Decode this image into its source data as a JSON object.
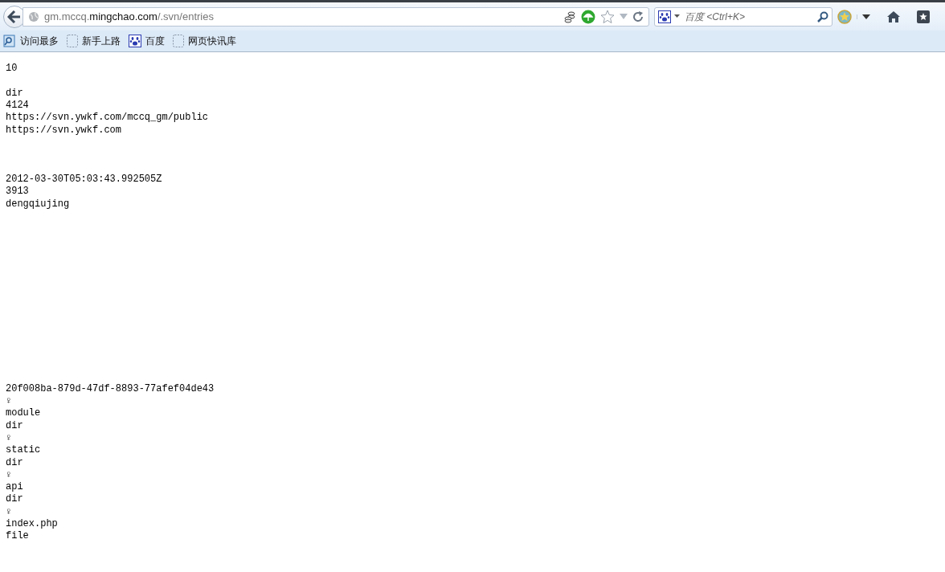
{
  "address_bar": {
    "url_parts": [
      {
        "text": "gm.mccq.",
        "kind": "dim"
      },
      {
        "text": "mingchao.com",
        "kind": "strong"
      },
      {
        "text": "/.svn/entries",
        "kind": "dim"
      }
    ]
  },
  "search": {
    "placeholder": "百度 <Ctrl+K>"
  },
  "bookmarks": [
    {
      "label": "访问最多",
      "kind": "folder"
    },
    {
      "label": "新手上路",
      "kind": "blank"
    },
    {
      "label": "百度",
      "kind": "paw"
    },
    {
      "label": "网页快讯库",
      "kind": "blank"
    }
  ],
  "page": {
    "content": "10\n\ndir\n4124\nhttps://svn.ywkf.com/mccq_gm/public\nhttps://svn.ywkf.com\n\n\n\n2012-03-30T05:03:43.992505Z\n3913\ndengqiujing\n\n\n\n\n\n\n\n\n\n\n\n\n\n\n20f008ba-879d-47df-8893-77afef04de43\n♀\nmodule\ndir\n♀\nstatic\ndir\n♀\napi\ndir\n♀\nindex.php\nfile"
  }
}
